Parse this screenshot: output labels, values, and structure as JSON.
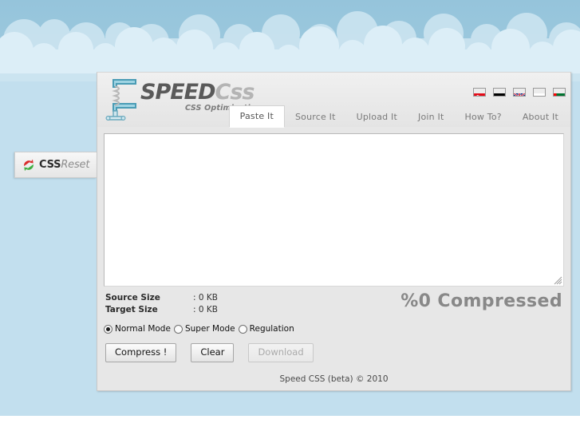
{
  "site": {
    "logo_main": "SPEED",
    "logo_accent": "Css",
    "logo_tagline": "CSS Optimization",
    "logo_icon": "clamp-icon"
  },
  "languages": [
    {
      "name": "Turkish",
      "code": "tr",
      "icon": "flag-tr-icon",
      "colors": [
        "#e30a17",
        "#ffffff"
      ]
    },
    {
      "name": "German",
      "code": "de",
      "icon": "flag-de-icon",
      "colors": [
        "#000000",
        "#dd0000",
        "#ffce00"
      ]
    },
    {
      "name": "English",
      "code": "en",
      "icon": "flag-gb-icon",
      "colors": [
        "#00247d",
        "#ffffff",
        "#cf142b"
      ]
    },
    {
      "name": "Russian",
      "code": "ru",
      "icon": "flag-ru-icon",
      "colors": [
        "#ffffff",
        "#0039a6",
        "#d52b1e"
      ]
    },
    {
      "name": "Arabic",
      "code": "ae",
      "icon": "flag-ae-icon",
      "colors": [
        "#00732f",
        "#ffffff",
        "#000000",
        "#ff0000"
      ]
    }
  ],
  "nav": {
    "tabs": [
      {
        "label": "Paste It",
        "active": true
      },
      {
        "label": "Source It",
        "active": false
      },
      {
        "label": "Upload It",
        "active": false
      },
      {
        "label": "Join It",
        "active": false
      },
      {
        "label": "How To?",
        "active": false
      },
      {
        "label": "About It",
        "active": false
      }
    ]
  },
  "editor": {
    "value": "",
    "placeholder": ""
  },
  "stats": {
    "source_label": "Source Size",
    "source_value": ": 0 KB",
    "target_label": "Target Size",
    "target_value": ": 0 KB",
    "compressed": "%0 Compressed"
  },
  "modes": {
    "options": [
      {
        "label": "Normal Mode",
        "selected": true
      },
      {
        "label": "Super Mode",
        "selected": false
      },
      {
        "label": "Regulation",
        "selected": false
      }
    ]
  },
  "buttons": {
    "compress": "Compress !",
    "clear": "Clear",
    "download": "Download",
    "download_disabled": true
  },
  "footer": {
    "text": "Speed CSS (beta) © 2010"
  },
  "css_reset": {
    "label_bold": "CSS",
    "label_light": "Reset",
    "icon": "refresh-circle-icon"
  },
  "theme": {
    "sky": "#9cc8dd",
    "sky_bottom": "#bfdcec",
    "cloud": "#d9ecf5",
    "panel_bg": "#e7e7e7",
    "panel_border": "#c9c9c9",
    "accent_text": "#888888"
  }
}
